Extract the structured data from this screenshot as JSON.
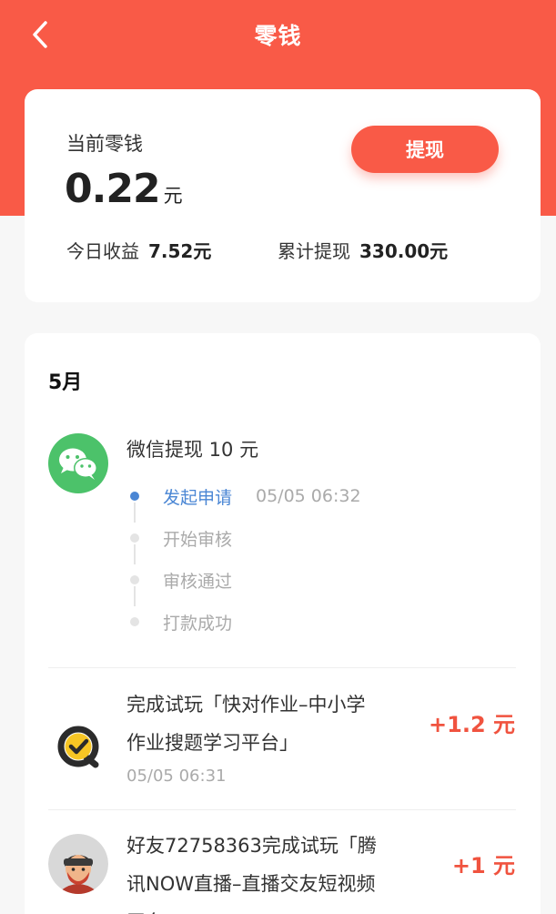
{
  "nav": {
    "title": "零钱"
  },
  "balance": {
    "label": "当前零钱",
    "value": "0.22",
    "unit": "元",
    "withdraw_label": "提现",
    "today_label": "今日收益",
    "today_value": "7.52元",
    "total_label": "累计提现",
    "total_value": "330.00元"
  },
  "records": {
    "month": "5月",
    "withdrawal": {
      "title": "微信提现 10 元",
      "steps": [
        {
          "label": "发起申请",
          "time": "05/05 06:32",
          "active": true
        },
        {
          "label": "开始审核",
          "time": "",
          "active": false
        },
        {
          "label": "审核通过",
          "time": "",
          "active": false
        },
        {
          "label": "打款成功",
          "time": "",
          "active": false
        }
      ]
    },
    "items": [
      {
        "line1": "完成试玩「快对作业–中小学",
        "line2": "作业搜题学习平台」",
        "time": "05/05 06:31",
        "amount": "+1.2 元",
        "icon": "kuaidui-app-icon"
      },
      {
        "line1": "好友72758363完成试玩「腾",
        "line2": "讯NOW直播–直播交友短视频",
        "line3": "平台」",
        "time": "",
        "amount": "+1 元",
        "icon": "friend-avatar"
      }
    ]
  },
  "colors": {
    "brand": "#f95a47",
    "active_step": "#4a86d4",
    "amount": "#f0533f",
    "wechat": "#4cc26a"
  }
}
